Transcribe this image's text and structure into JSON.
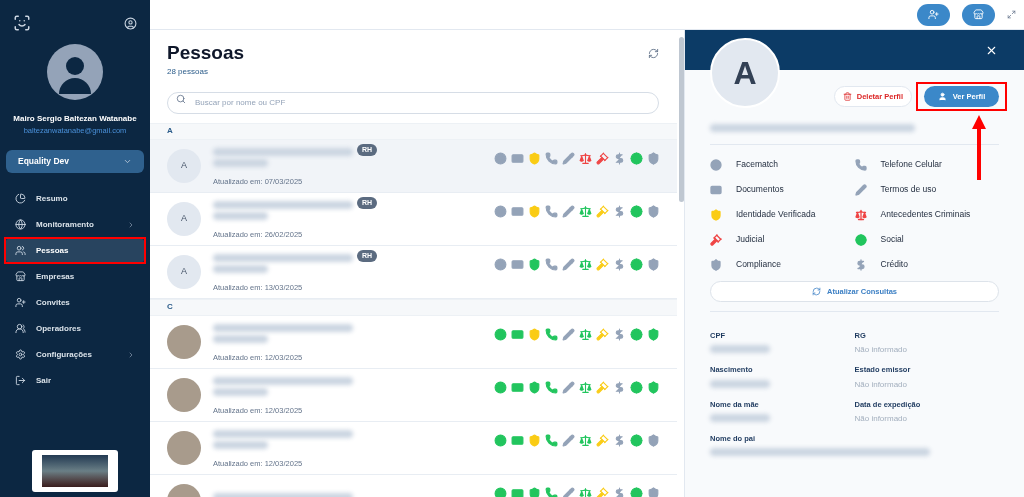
{
  "sidebar": {
    "user": {
      "name": "Mairo Sergio Baltezan Watanabe",
      "email": "baltezanwatanabe@gmail.com"
    },
    "workspace": {
      "label": "Equality Dev"
    },
    "nav": [
      {
        "label": "Resumo",
        "submenu": false,
        "selected": false,
        "highlighted": false
      },
      {
        "label": "Monitoramento",
        "submenu": true,
        "selected": false,
        "highlighted": false
      },
      {
        "label": "Pessoas",
        "submenu": false,
        "selected": true,
        "highlighted": true
      },
      {
        "label": "Empresas",
        "submenu": false,
        "selected": false,
        "highlighted": false
      },
      {
        "label": "Convites",
        "submenu": false,
        "selected": false,
        "highlighted": false
      },
      {
        "label": "Operadores",
        "submenu": false,
        "selected": false,
        "highlighted": false
      },
      {
        "label": "Configurações",
        "submenu": true,
        "selected": false,
        "highlighted": false
      },
      {
        "label": "Sair",
        "submenu": false,
        "selected": false,
        "highlighted": false
      }
    ]
  },
  "list": {
    "title": "Pessoas",
    "count": "28 pessoas",
    "search": {
      "placeholder": "Buscar por nome ou CPF"
    },
    "sections": [
      {
        "letter": "A",
        "people": [
          {
            "initial": "A",
            "tag": "RH",
            "updated": "Atualizado em: 07/03/2025",
            "selected": true,
            "checks": [
              {
                "color": "#94a3b8"
              },
              {
                "color": "#94a3b8"
              },
              {
                "color": "#facc15"
              },
              {
                "color": "#94a3b8"
              },
              {
                "color": "#94a3b8"
              },
              {
                "color": "#ef4444"
              },
              {
                "color": "#ef4444"
              },
              {
                "color": "#94a3b8"
              },
              {
                "color": "#22c55e"
              },
              {
                "color": "#94a3b8"
              }
            ]
          },
          {
            "initial": "A",
            "tag": "RH",
            "updated": "Atualizado em: 26/02/2025",
            "selected": false,
            "checks": [
              {
                "color": "#94a3b8"
              },
              {
                "color": "#94a3b8"
              },
              {
                "color": "#facc15"
              },
              {
                "color": "#94a3b8"
              },
              {
                "color": "#94a3b8"
              },
              {
                "color": "#22c55e"
              },
              {
                "color": "#facc15"
              },
              {
                "color": "#94a3b8"
              },
              {
                "color": "#22c55e"
              },
              {
                "color": "#94a3b8"
              }
            ]
          },
          {
            "initial": "A",
            "tag": "RH",
            "updated": "Atualizado em: 13/03/2025",
            "selected": false,
            "checks": [
              {
                "color": "#94a3b8"
              },
              {
                "color": "#94a3b8"
              },
              {
                "color": "#22c55e"
              },
              {
                "color": "#94a3b8"
              },
              {
                "color": "#94a3b8"
              },
              {
                "color": "#22c55e"
              },
              {
                "color": "#facc15"
              },
              {
                "color": "#94a3b8"
              },
              {
                "color": "#22c55e"
              },
              {
                "color": "#94a3b8"
              }
            ]
          }
        ]
      },
      {
        "letter": "C",
        "people": [
          {
            "updated": "Atualizado em: 12/03/2025",
            "selected": false,
            "checks": [
              {
                "color": "#22c55e"
              },
              {
                "color": "#22c55e"
              },
              {
                "color": "#facc15"
              },
              {
                "color": "#22c55e"
              },
              {
                "color": "#94a3b8"
              },
              {
                "color": "#22c55e"
              },
              {
                "color": "#facc15"
              },
              {
                "color": "#94a3b8"
              },
              {
                "color": "#22c55e"
              },
              {
                "color": "#22c55e"
              }
            ]
          },
          {
            "updated": "Atualizado em: 12/03/2025",
            "selected": false,
            "checks": [
              {
                "color": "#22c55e"
              },
              {
                "color": "#22c55e"
              },
              {
                "color": "#22c55e"
              },
              {
                "color": "#22c55e"
              },
              {
                "color": "#94a3b8"
              },
              {
                "color": "#22c55e"
              },
              {
                "color": "#facc15"
              },
              {
                "color": "#94a3b8"
              },
              {
                "color": "#22c55e"
              },
              {
                "color": "#22c55e"
              }
            ]
          },
          {
            "updated": "Atualizado em: 12/03/2025",
            "selected": false,
            "checks": [
              {
                "color": "#22c55e"
              },
              {
                "color": "#22c55e"
              },
              {
                "color": "#facc15"
              },
              {
                "color": "#22c55e"
              },
              {
                "color": "#94a3b8"
              },
              {
                "color": "#22c55e"
              },
              {
                "color": "#facc15"
              },
              {
                "color": "#94a3b8"
              },
              {
                "color": "#22c55e"
              },
              {
                "color": "#94a3b8"
              }
            ]
          },
          {
            "selected": false,
            "checks": [
              {
                "color": "#22c55e"
              },
              {
                "color": "#22c55e"
              },
              {
                "color": "#22c55e"
              },
              {
                "color": "#22c55e"
              },
              {
                "color": "#94a3b8"
              },
              {
                "color": "#22c55e"
              },
              {
                "color": "#facc15"
              },
              {
                "color": "#94a3b8"
              },
              {
                "color": "#22c55e"
              },
              {
                "color": "#94a3b8"
              }
            ]
          }
        ]
      }
    ]
  },
  "panel": {
    "initial": "A",
    "delete_button": {
      "label": "Deletar Perfil"
    },
    "view_button": {
      "label": "Ver Perfil",
      "highlighted": true
    },
    "checks": [
      {
        "kind": "face",
        "label": "Facematch",
        "color": "#94a3b8"
      },
      {
        "kind": "phone",
        "label": "Telefone Celular",
        "color": "#94a3b8"
      },
      {
        "kind": "id",
        "label": "Documentos",
        "color": "#94a3b8"
      },
      {
        "kind": "pencil",
        "label": "Termos de uso",
        "color": "#94a3b8"
      },
      {
        "kind": "shield-check",
        "label": "Identidade Verificada",
        "color": "#facc15"
      },
      {
        "kind": "scale",
        "label": "Antecedentes Criminais",
        "color": "#ef4444"
      },
      {
        "kind": "gavel",
        "label": "Judicial",
        "color": "#ef4444"
      },
      {
        "kind": "globe",
        "label": "Social",
        "color": "#22c55e"
      },
      {
        "kind": "shield-half",
        "label": "Compliance",
        "color": "#94a3b8"
      },
      {
        "kind": "dollar",
        "label": "Crédito",
        "color": "#94a3b8"
      }
    ],
    "refresh_button": {
      "label": "Atualizar Consultas"
    },
    "fields": [
      {
        "label": "CPF",
        "kind": "redacted"
      },
      {
        "label": "RG",
        "kind": "text",
        "value": "Não informado"
      },
      {
        "label": "Nascimento",
        "kind": "redacted"
      },
      {
        "label": "Estado emissor",
        "kind": "text",
        "value": "Não informado"
      },
      {
        "label": "Nome da mãe",
        "kind": "redacted"
      },
      {
        "label": "Data de expedição",
        "kind": "text",
        "value": "Não informado"
      },
      {
        "label": "Nome do pai",
        "kind": "redacted"
      }
    ]
  }
}
